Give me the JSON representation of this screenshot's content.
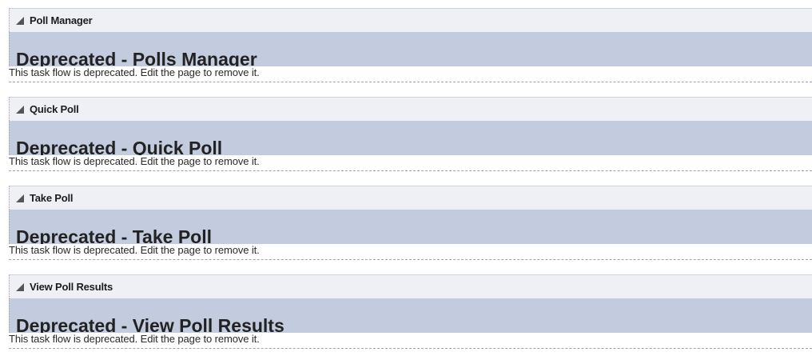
{
  "panels": [
    {
      "title": "Poll Manager",
      "heading": "Deprecated - Polls Manager",
      "message": "This task flow is deprecated. Edit the page to remove it."
    },
    {
      "title": "Quick Poll",
      "heading": "Deprecated - Quick Poll",
      "message": "This task flow is deprecated. Edit the page to remove it."
    },
    {
      "title": "Take Poll",
      "heading": "Deprecated - Take Poll",
      "message": "This task flow is deprecated. Edit the page to remove it."
    },
    {
      "title": "View Poll Results",
      "heading": "Deprecated - View Poll Results",
      "message": "This task flow is deprecated. Edit the page to remove it."
    }
  ],
  "icons": {
    "collapse": "collapse-triangle-icon"
  },
  "colors": {
    "header_bg": "#eef0f6",
    "body_bg": "#c3cbde",
    "border": "#9aa2b4"
  }
}
